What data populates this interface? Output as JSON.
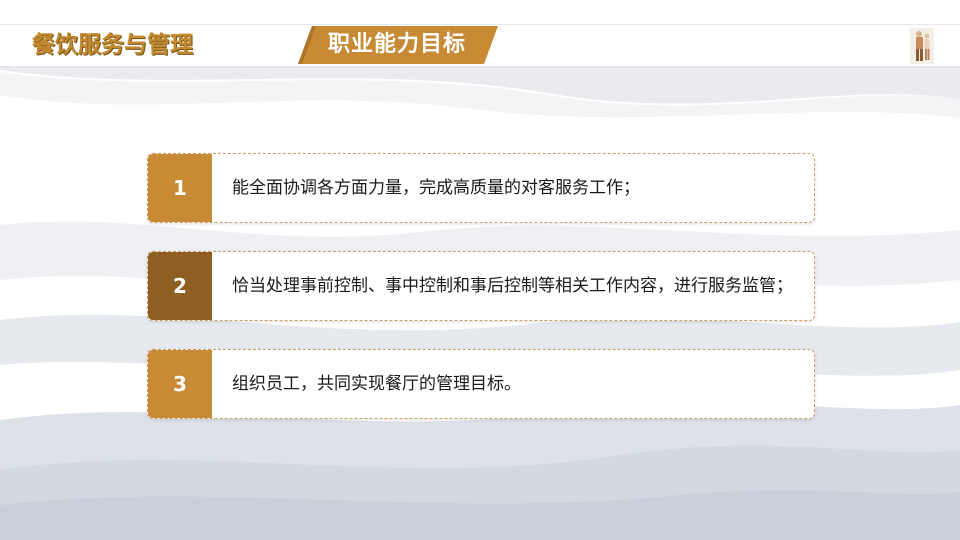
{
  "header": {
    "brand_title": "餐饮服务与管理",
    "section_title": "职业能力目标"
  },
  "colors": {
    "brand_gold": "#c2892e",
    "number_gold": "#c88a35",
    "number_brown": "#8e5e22",
    "dashed_border": "#c9a06a",
    "wave_gray": "#dfe3e8"
  },
  "icons": {
    "logo": "chef-figure-logo-icon"
  },
  "items": [
    {
      "number": "1",
      "text": "能全面协调各方面力量，完成高质量的对客服务工作；"
    },
    {
      "number": "2",
      "text": "恰当处理事前控制、事中控制和事后控制等相关工作内容，进行服务监管；"
    },
    {
      "number": "3",
      "text": "组织员工，共同实现餐厅的管理目标。"
    }
  ]
}
